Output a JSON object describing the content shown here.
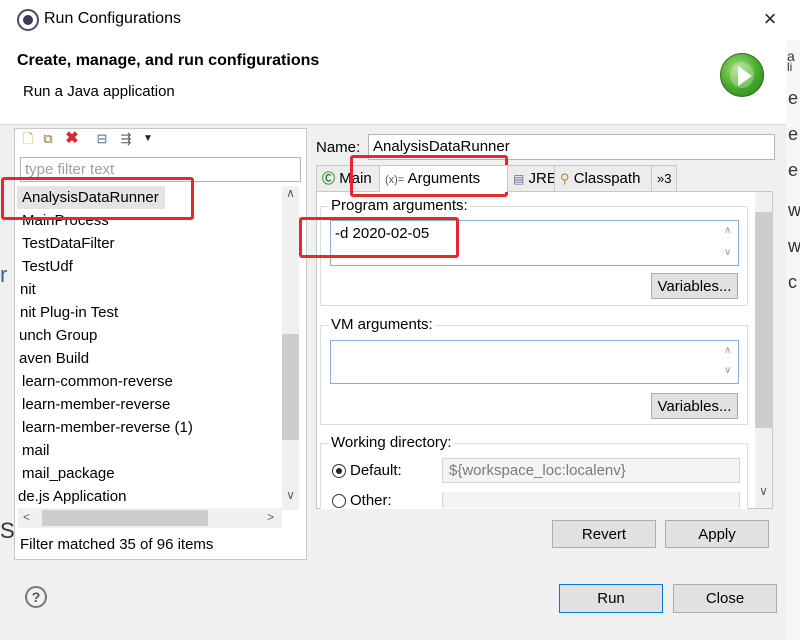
{
  "window": {
    "title": "Run Configurations",
    "close_glyph": "×"
  },
  "header": {
    "title": "Create, manage, and run configurations",
    "description": "Run a Java application"
  },
  "left_panel": {
    "toolbar_icons": [
      "new-config-icon",
      "duplicate-icon",
      "delete-icon",
      "collapse-all-icon",
      "filter-icon",
      "menu-dropdown-icon"
    ],
    "filter_placeholder": "type filter text",
    "tree_items": [
      "AnalysisDataRunner",
      "MainProcess",
      "TestDataFilter",
      "TestUdf",
      "nit",
      "nit Plug-in Test",
      "unch Group",
      "aven Build",
      "learn-common-reverse",
      "learn-member-reverse",
      "learn-member-reverse (1)",
      "mail",
      "mail_package",
      "de.js Application"
    ],
    "selected_item": "AnalysisDataRunner",
    "status": "Filter matched 35 of 96 items"
  },
  "right_panel": {
    "name_label": "Name:",
    "name_value": "AnalysisDataRunner",
    "tabs": [
      "Main",
      "Arguments",
      "JRE",
      "Classpath",
      "»3"
    ],
    "active_tab": "Arguments",
    "program_args_label": "Program arguments:",
    "program_args_value": "-d 2020-02-05",
    "variables_label": "Variables...",
    "vm_args_label": "VM arguments:",
    "vm_args_value": "",
    "working_dir_label": "Working directory:",
    "default_label": "Default:",
    "default_value": "${workspace_loc:localenv}",
    "other_label": "Other:"
  },
  "buttons": {
    "revert": "Revert",
    "apply": "Apply",
    "run": "Run",
    "close": "Close"
  },
  "background_window_fragments": [
    "a",
    "li",
    "e",
    "e",
    "e",
    "w",
    "w",
    "c"
  ],
  "background_left_fragments": [
    "r",
    "S"
  ],
  "annotation_color": "#e8262b"
}
